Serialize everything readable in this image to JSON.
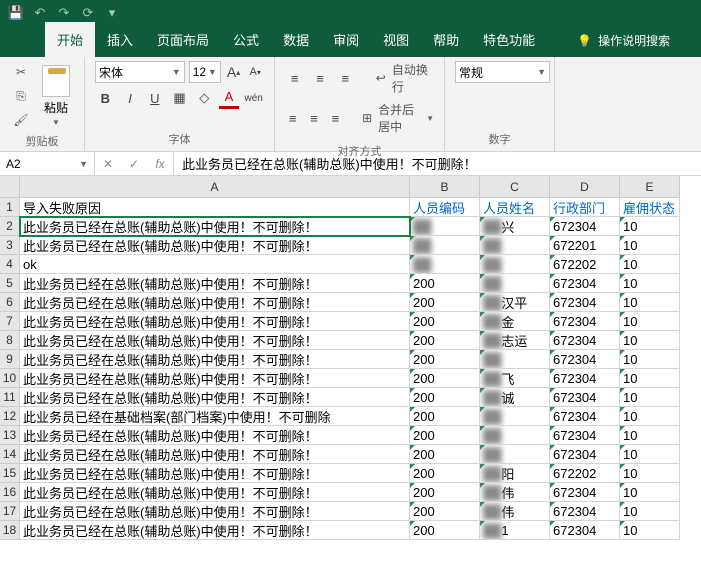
{
  "titlebar": {
    "qat_icons": [
      "save",
      "undo",
      "redo",
      "refresh",
      "more"
    ]
  },
  "tabs": {
    "items": [
      "开始",
      "插入",
      "页面布局",
      "公式",
      "数据",
      "审阅",
      "视图",
      "帮助",
      "特色功能"
    ],
    "active": 0,
    "help_search": "操作说明搜索"
  },
  "ribbon": {
    "clipboard": {
      "paste": "粘贴",
      "label": "剪贴板"
    },
    "font": {
      "name": "宋体",
      "size": "12",
      "label": "字体",
      "aa_up": "A",
      "aa_dn": "A",
      "sub": "wén"
    },
    "align": {
      "wrap": "自动换行",
      "merge": "合并后居中",
      "label": "对齐方式"
    },
    "number": {
      "format": "常规",
      "label": "数字"
    }
  },
  "formula_bar": {
    "cell_ref": "A2",
    "fx": "fx",
    "value": "此业务员已经在总账(辅助总账)中使用！不可删除！"
  },
  "columns": [
    "A",
    "B",
    "C",
    "D",
    "E"
  ],
  "headers": {
    "A": "导入失败原因",
    "B": "人员编码",
    "C": "人员姓名",
    "D": "行政部门",
    "E": "雇佣状态"
  },
  "rows": [
    {
      "n": 2,
      "a": "此业务员已经在总账(辅助总账)中使用！不可删除！",
      "c_suffix": "兴",
      "d": "672304",
      "e": "10"
    },
    {
      "n": 3,
      "a": "此业务员已经在总账(辅助总账)中使用！不可删除！",
      "d": "672201",
      "e": "10"
    },
    {
      "n": 4,
      "a": "ok",
      "d": "672202",
      "e": "10"
    },
    {
      "n": 5,
      "a": "此业务员已经在总账(辅助总账)中使用！不可删除！",
      "b": "200",
      "d": "672304",
      "e": "10"
    },
    {
      "n": 6,
      "a": "此业务员已经在总账(辅助总账)中使用！不可删除！",
      "b": "200",
      "c_suffix": "汉平",
      "d": "672304",
      "e": "10"
    },
    {
      "n": 7,
      "a": "此业务员已经在总账(辅助总账)中使用！不可删除！",
      "b": "200",
      "c_suffix": "金",
      "d": "672304",
      "e": "10"
    },
    {
      "n": 8,
      "a": "此业务员已经在总账(辅助总账)中使用！不可删除！",
      "b": "200",
      "c_suffix": "志运",
      "d": "672304",
      "e": "10"
    },
    {
      "n": 9,
      "a": "此业务员已经在总账(辅助总账)中使用！不可删除！",
      "b": "200",
      "d": "672304",
      "e": "10"
    },
    {
      "n": 10,
      "a": "此业务员已经在总账(辅助总账)中使用！不可删除！",
      "b": "200",
      "c_suffix": "飞",
      "d": "672304",
      "e": "10"
    },
    {
      "n": 11,
      "a": "此业务员已经在总账(辅助总账)中使用！不可删除！",
      "b": "200",
      "c_suffix": "诚",
      "d": "672304",
      "e": "10"
    },
    {
      "n": 12,
      "a": "此业务员已经在基础档案(部门档案)中使用！不可删除",
      "b": "200",
      "d": "672304",
      "e": "10"
    },
    {
      "n": 13,
      "a": "此业务员已经在总账(辅助总账)中使用！不可删除！",
      "b": "200",
      "d": "672304",
      "e": "10"
    },
    {
      "n": 14,
      "a": "此业务员已经在总账(辅助总账)中使用！不可删除！",
      "b": "200",
      "d": "672304",
      "e": "10"
    },
    {
      "n": 15,
      "a": "此业务员已经在总账(辅助总账)中使用！不可删除！",
      "b": "200",
      "c_suffix": "阳",
      "d": "672202",
      "e": "10"
    },
    {
      "n": 16,
      "a": "此业务员已经在总账(辅助总账)中使用！不可删除！",
      "b": "200",
      "c_suffix": "伟",
      "d": "672304",
      "e": "10"
    },
    {
      "n": 17,
      "a": "此业务员已经在总账(辅助总账)中使用！不可删除！",
      "b": "200",
      "c_suffix": "伟",
      "d": "672304",
      "e": "10"
    },
    {
      "n": 18,
      "a": "此业务员已经在总账(辅助总账)中使用！不可删除！",
      "b": "200",
      "c_suffix": "1",
      "d": "672304",
      "e": "10"
    }
  ]
}
